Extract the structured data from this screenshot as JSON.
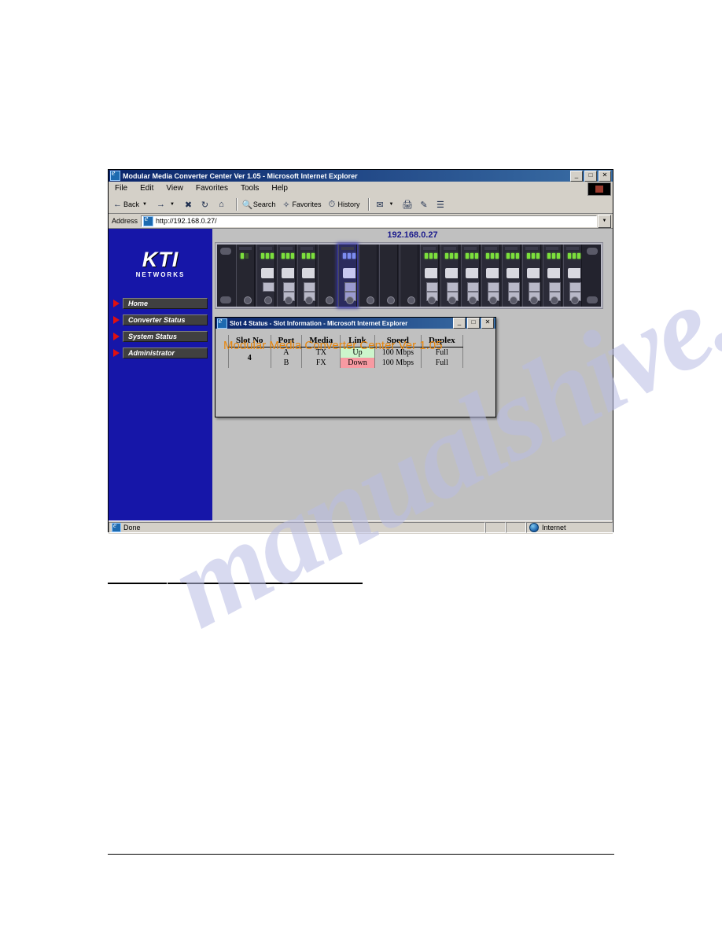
{
  "browser": {
    "title": "Modular Media Converter Center Ver 1.05 - Microsoft Internet Explorer",
    "window_buttons": {
      "minimize": "_",
      "restore": "□",
      "close": "✕"
    },
    "menu": [
      "File",
      "Edit",
      "View",
      "Favorites",
      "Tools",
      "Help"
    ],
    "toolbar": {
      "back": "Back",
      "forward": "",
      "stop": "",
      "refresh": "",
      "home": "",
      "search": "Search",
      "favorites": "Favorites",
      "history": "History",
      "mail": "",
      "print": "",
      "edit": "",
      "discuss": ""
    },
    "address": {
      "label": "Address",
      "value": "http://192.168.0.27/"
    },
    "statusbar": {
      "message": "Done",
      "zone": "Internet"
    }
  },
  "sidebar": {
    "logo_main": "KTI",
    "logo_sub": "NETWORKS",
    "items": [
      {
        "label": "Home"
      },
      {
        "label": "Converter Status"
      },
      {
        "label": "System Status"
      },
      {
        "label": "Administrator"
      }
    ]
  },
  "page": {
    "device_ip": "192.168.0.27",
    "footer_title": "Modular Media Converter Center Ver 1.05",
    "footer_title_color": "#e8860c",
    "device_ip_color": "#1a1a8c"
  },
  "rack": {
    "slot_count": 16,
    "selected_slot": 4,
    "modules": [
      {
        "type": "power",
        "leds": [
          "on",
          "off",
          "off"
        ],
        "selected": false
      },
      {
        "type": "management",
        "leds": [
          "on",
          "on",
          "on"
        ],
        "selected": false
      },
      {
        "type": "converter",
        "leds": [
          "on",
          "on",
          "on"
        ],
        "selected": false
      },
      {
        "type": "converter",
        "leds": [
          "on",
          "on",
          "on"
        ],
        "selected": false
      },
      {
        "type": "blank",
        "leds": [],
        "selected": false
      },
      {
        "type": "converter",
        "leds": [
          "blue",
          "blue",
          "blue"
        ],
        "selected": true
      },
      {
        "type": "blank",
        "leds": [],
        "selected": false
      },
      {
        "type": "blank",
        "leds": [],
        "selected": false
      },
      {
        "type": "blank",
        "leds": [],
        "selected": false
      },
      {
        "type": "converter",
        "leds": [
          "on",
          "on",
          "on"
        ],
        "selected": false
      },
      {
        "type": "converter",
        "leds": [
          "on",
          "on",
          "on"
        ],
        "selected": false
      },
      {
        "type": "converter",
        "leds": [
          "on",
          "on",
          "on"
        ],
        "selected": false
      },
      {
        "type": "converter",
        "leds": [
          "on",
          "on",
          "on"
        ],
        "selected": false
      },
      {
        "type": "converter",
        "leds": [
          "on",
          "on",
          "on"
        ],
        "selected": false
      },
      {
        "type": "converter",
        "leds": [
          "on",
          "on",
          "on"
        ],
        "selected": false
      },
      {
        "type": "converter",
        "leds": [
          "on",
          "on",
          "on"
        ],
        "selected": false
      },
      {
        "type": "converter",
        "leds": [
          "on",
          "on",
          "on"
        ],
        "selected": false
      }
    ]
  },
  "popup": {
    "title": "Slot 4 Status - Slot Information - Microsoft Internet Explorer",
    "window_buttons": {
      "minimize": "_",
      "restore": "□",
      "close": "✕"
    },
    "table": {
      "headers": [
        "Slot No",
        "Port",
        "Media",
        "Link",
        "Speed",
        "Duplex"
      ],
      "slot_no": "4",
      "rows": [
        {
          "port": "A",
          "media": "TX",
          "link": "Up",
          "link_state": "up",
          "speed": "100 Mbps",
          "duplex": "Full"
        },
        {
          "port": "B",
          "media": "FX",
          "link": "Down",
          "link_state": "down",
          "speed": "100 Mbps",
          "duplex": "Full"
        }
      ],
      "link_up_color": "#ccf5cc",
      "link_down_color": "#f79aa2"
    }
  },
  "watermark": {
    "text": "manualshive.com"
  }
}
